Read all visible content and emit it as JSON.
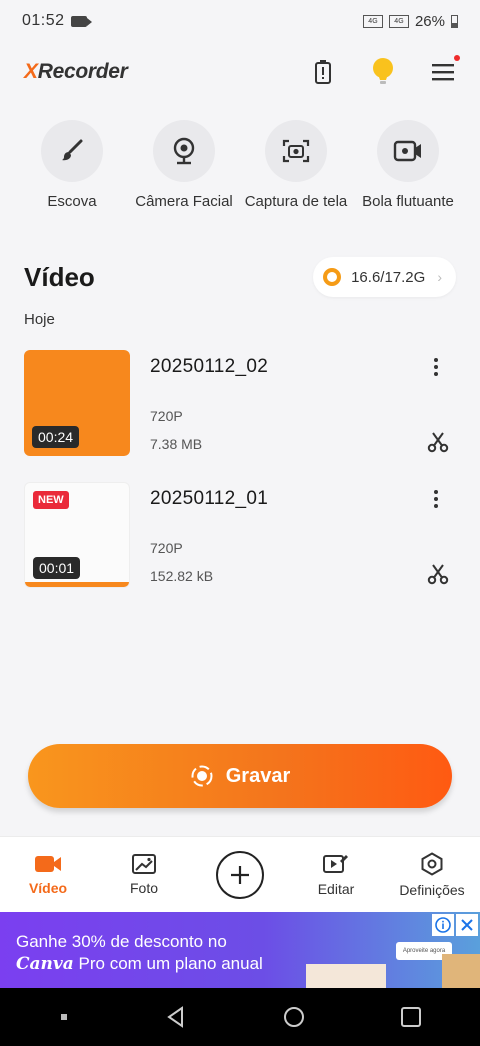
{
  "status": {
    "time": "01:52",
    "sig1": "4G",
    "sig2": "4G",
    "battery": "26%"
  },
  "app": {
    "logo_x": "X",
    "logo_rest": "Recorder"
  },
  "tools": [
    {
      "label": "Escova",
      "icon": "brush-icon"
    },
    {
      "label": "Câmera Facial",
      "icon": "webcam-icon"
    },
    {
      "label": "Captura de tela",
      "icon": "screenshot-icon"
    },
    {
      "label": "Bola flutuante",
      "icon": "floating-camera-icon"
    }
  ],
  "videos_section": {
    "title": "Vídeo",
    "storage": "16.6/17.2G",
    "day": "Hoje",
    "items": [
      {
        "title": "20250112_02",
        "resolution": "720P",
        "size": "7.38 MB",
        "duration": "00:24",
        "badge": ""
      },
      {
        "title": "20250112_01",
        "resolution": "720P",
        "size": "152.82 kB",
        "duration": "00:01",
        "badge": "NEW"
      }
    ]
  },
  "record_button": {
    "label": "Gravar"
  },
  "bottom_nav": [
    {
      "label": "Vídeo",
      "icon": "video-camera-icon",
      "active": true
    },
    {
      "label": "Foto",
      "icon": "photo-icon",
      "active": false
    },
    {
      "label": "",
      "icon": "plus-circle-icon",
      "active": false
    },
    {
      "label": "Editar",
      "icon": "edit-video-icon",
      "active": false
    },
    {
      "label": "Definições",
      "icon": "settings-hex-icon",
      "active": false
    }
  ],
  "ad": {
    "line1": "Ganhe 30% de desconto no",
    "brand": "Canva",
    "line2_rest": " Pro com um plano anual",
    "cta": "Aproveite agora"
  },
  "colors": {
    "accent": "#f46a1a",
    "orange": "#f7881d",
    "new_badge": "#ea2a3a"
  }
}
